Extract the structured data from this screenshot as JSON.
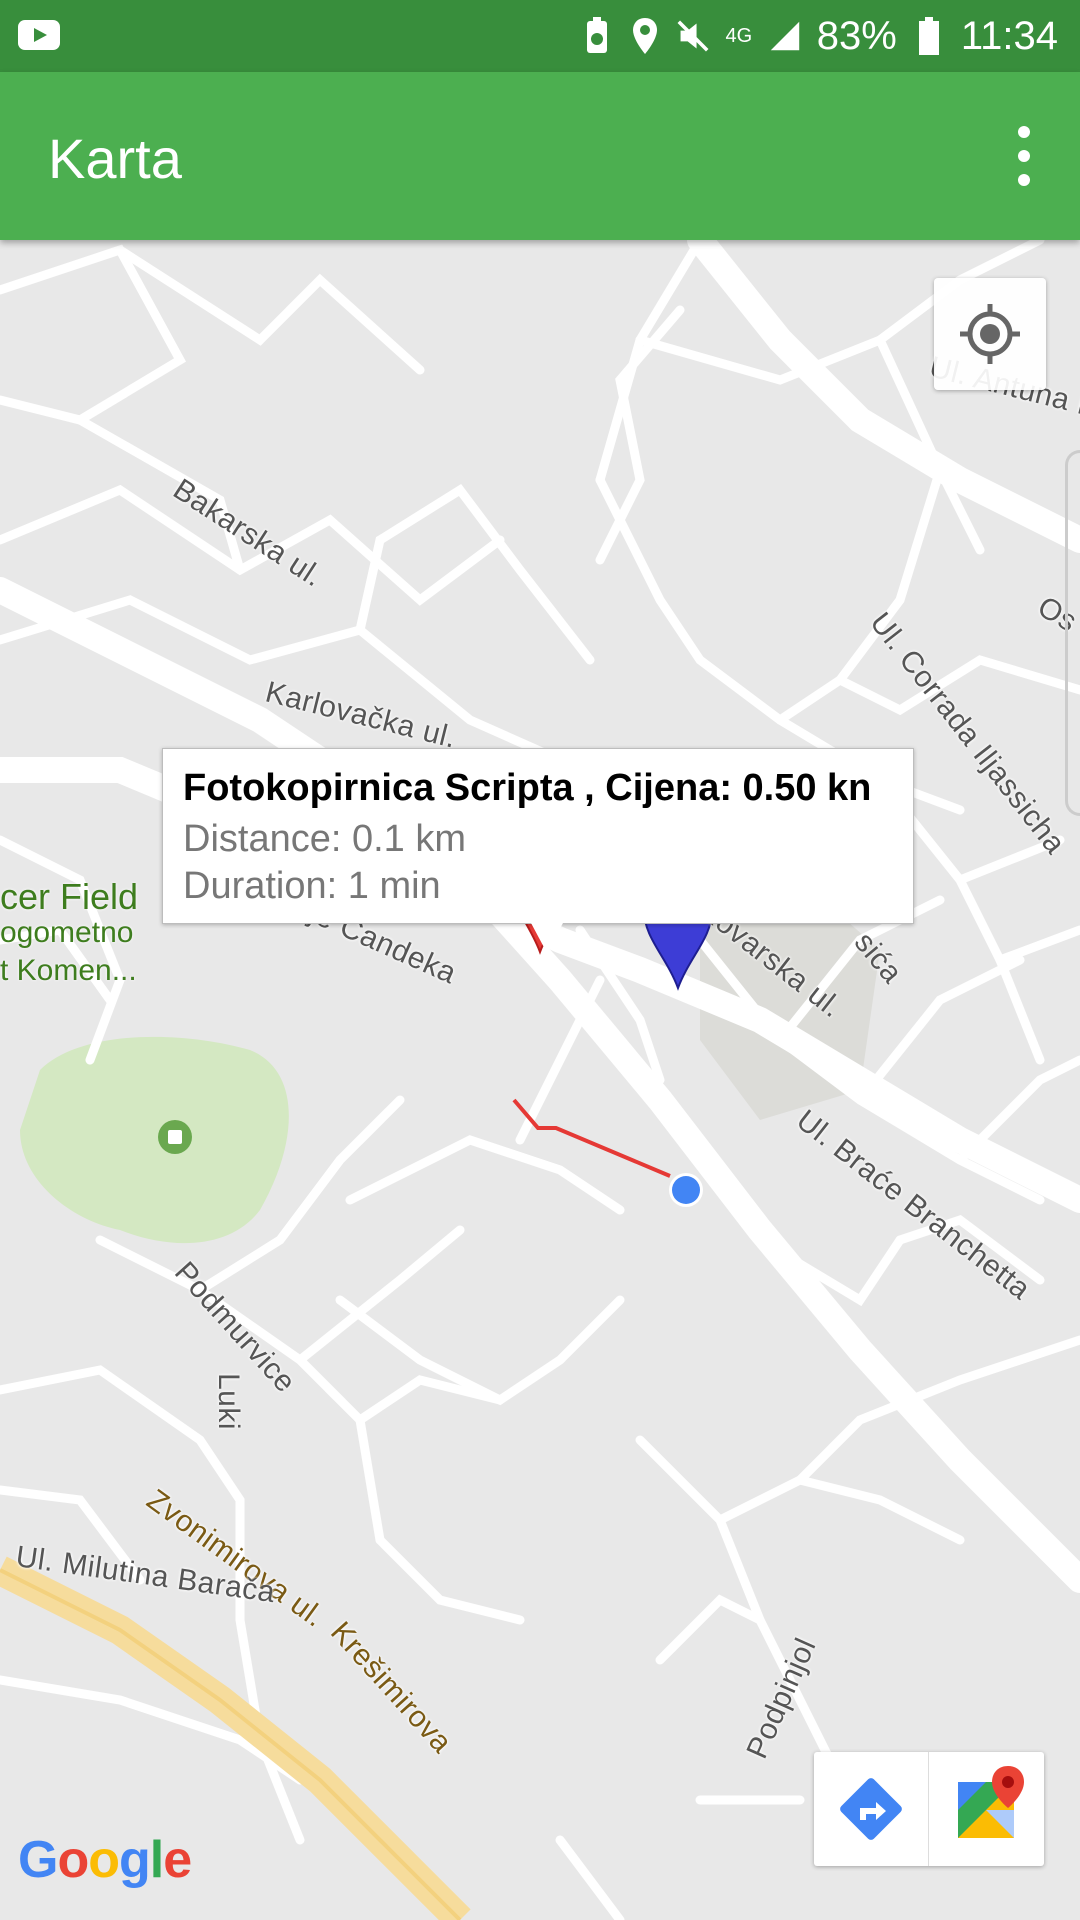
{
  "status_bar": {
    "network": "4G",
    "battery": "83%",
    "time": "11:34"
  },
  "app_bar": {
    "title": "Karta"
  },
  "info_window": {
    "title": "Fotokopirnica Scripta , Cijena: 0.50 kn",
    "distance": "Distance: 0.1 km",
    "duration": "Duration: 1 min"
  },
  "map": {
    "streets": {
      "bakarska": "Bakarska ul.",
      "karlovacka": "Karlovačka ul.",
      "corrada": "Ul. Corrada Iljassicha",
      "antuna": "Ul. Antuna I",
      "os": "Os",
      "candeka": "Ul. Franje Čandeka",
      "vukovarska": "Vukovarska ul.",
      "brace": "Ul. Braće Branchetta",
      "podmurvice": "Podmurvice",
      "luki": "Luki",
      "zvonimirova": "Zvonimirova ul.",
      "kresimirova": "Krešimirova",
      "milutina": "Ul. Milutina Barača",
      "podpinjol": "Podpinjol",
      "sica": "sića"
    },
    "park": {
      "line1": "cer Field",
      "line2": "ogometno",
      "line3": "t Komen..."
    },
    "logo": "Google"
  },
  "colors": {
    "status_bar": "#388e3c",
    "app_bar": "#4caf50",
    "route": "#e53935",
    "destination_marker": "#e53935",
    "origin_marker": "#3d3dd6",
    "my_location": "#4285f4",
    "park": "#d4e8c2"
  },
  "icons": [
    "youtube-icon",
    "battery-saver-icon",
    "location-icon",
    "mute-icon",
    "signal-icon",
    "battery-icon",
    "overflow-menu-icon",
    "my-location-icon",
    "directions-icon",
    "google-maps-icon"
  ]
}
